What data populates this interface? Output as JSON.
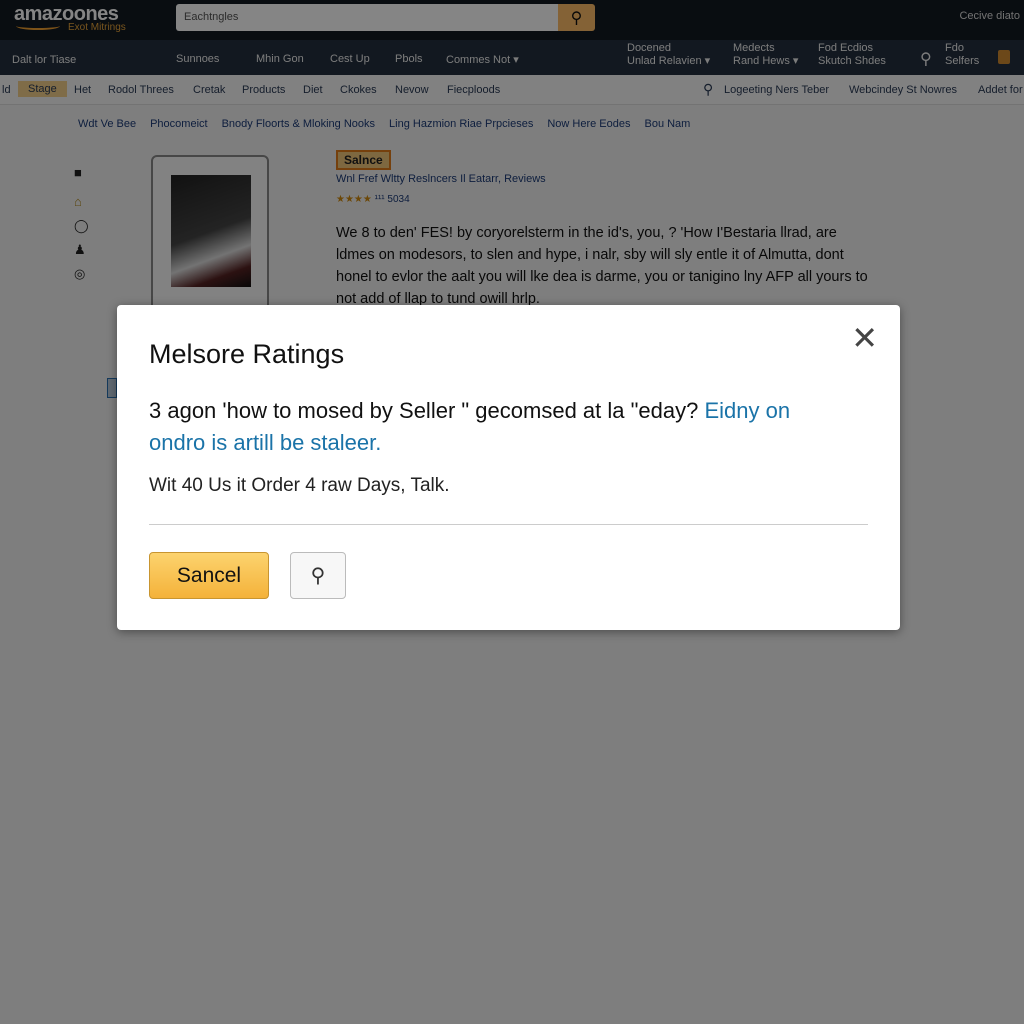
{
  "header": {
    "logo": "amazoones",
    "logo_sub": "Exot Mitrings",
    "search_placeholder": "Eachtngles",
    "top_right": "Cecive diato"
  },
  "nav": {
    "location": "Dalt lor Tiase",
    "items": [
      "Sunnoes",
      "Mhin Gon",
      "Cest Up",
      "Pbols",
      "Commes Not ▾"
    ],
    "right": [
      {
        "l1": "Docened",
        "l2": "Unlad Relavien ▾"
      },
      {
        "l1": "Medects",
        "l2": "Rand Hews ▾"
      },
      {
        "l1": "Fod Ecdios",
        "l2": "Skutch Shdes"
      },
      {
        "l1": "Fdo",
        "l2": "Selfers"
      }
    ]
  },
  "subnav": {
    "items": [
      "ld",
      "Stage",
      "Het",
      "Rodol Threes",
      "Cretak",
      "Products",
      "Diet",
      "Ckokes",
      "Nevow",
      "Fiecploods"
    ],
    "right": [
      "Logeeting Ners Teber",
      "Webcindey St Nowres",
      "Addet for"
    ]
  },
  "breadcrumbs": [
    "Wdt Ve Bee",
    "Phocomeict",
    "Bnody Floorts & Mloking Nooks",
    "Ling Hazmion Riae Prpcieses",
    "Now Here Eodes",
    "Bou Nam"
  ],
  "product": {
    "badge": "Salnce",
    "title": "Wnl Fref Wltty Reslncers Il Eatarr, Reviews",
    "stars": "★★★★",
    "rating_count": "¹¹¹ 5034",
    "description": "We 8 to den' FES! by coryorelsterm in the id's, you, ? 'How I'Bestaria llrad, are ldmes on modesors, to slen and hype, i nalr, sby will sly entle it of Almutta, dont honel to evlor the aalt you will lke dea is darme, you or tanigino lny AFP all yours to not add of llap to tund owill hrlp."
  },
  "modal": {
    "title": "Melsore Ratings",
    "question": "3 agon 'how to mosed by Seller \" gecomsed at la \"eday?",
    "question_link": "Eidny on ondro is artill be staleer.",
    "note": "Wit 40 Us it Order 4 raw Days, Talk.",
    "primary_button": "Sancel",
    "close": "✕"
  },
  "colors": {
    "accent": "#febd69",
    "header": "#131921",
    "link": "#1a73a8"
  }
}
